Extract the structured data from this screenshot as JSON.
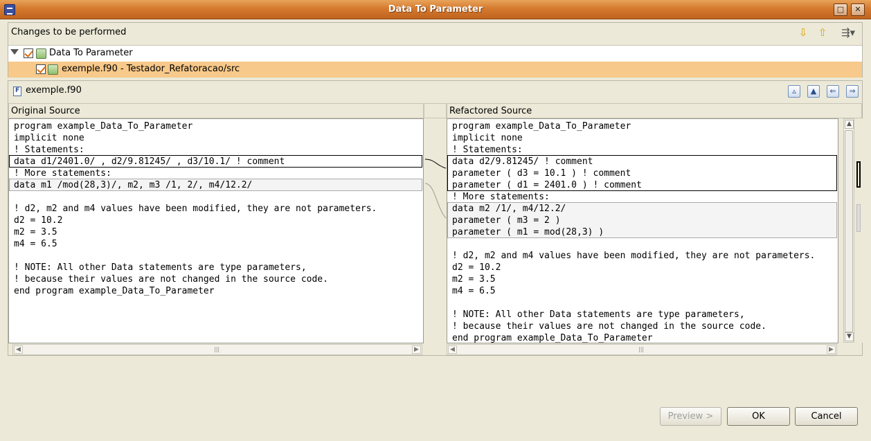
{
  "window": {
    "title": "Data To Parameter"
  },
  "changes": {
    "title": "Changes to be performed",
    "tree": [
      {
        "label": "Data To Parameter",
        "checked": true,
        "selected": false
      },
      {
        "label": "exemple.f90 - Testador_Refatoracao/src",
        "checked": true,
        "selected": true
      }
    ]
  },
  "compare": {
    "file_name": "exemple.f90",
    "left_header": "Original Source",
    "right_header": "Refactored Source",
    "left_lines": [
      "program example_Data_To_Parameter",
      "implicit none",
      "! Statements:",
      "data d1/2401.0/ , d2/9.81245/ , d3/10.1/ ! comment",
      "! More statements:",
      "data m1 /mod(28,3)/, m2, m3 /1, 2/, m4/12.2/",
      "",
      "! d2, m2 and m4 values have been modified, they are not parameters.",
      "d2 = 10.2",
      "m2 = 3.5",
      "m4 = 6.5",
      "",
      "! NOTE: All other Data statements are type parameters,",
      "! because their values are not changed in the source code.",
      "end program example_Data_To_Parameter"
    ],
    "right_lines": [
      "program example_Data_To_Parameter",
      "implicit none",
      "! Statements:",
      "data d2/9.81245/ ! comment",
      "parameter ( d3 = 10.1 ) ! comment",
      "parameter ( d1 = 2401.0 ) ! comment",
      "! More statements:",
      "data m2 /1/, m4/12.2/",
      "parameter ( m3 = 2 )",
      "parameter ( m1 = mod(28,3) )",
      "",
      "! d2, m2 and m4 values have been modified, they are not parameters.",
      "d2 = 10.2",
      "m2 = 3.5",
      "m4 = 6.5",
      "",
      "! NOTE: All other Data statements are type parameters,",
      "! because their values are not changed in the source code.",
      "end program example_Data_To_Parameter"
    ]
  },
  "buttons": {
    "preview": "Preview >",
    "ok": "OK",
    "cancel": "Cancel"
  },
  "icons": {
    "down": "arrow-down-icon",
    "up": "arrow-up-icon",
    "layout": "layout-menu-icon",
    "app": "eclipse-app-icon"
  }
}
